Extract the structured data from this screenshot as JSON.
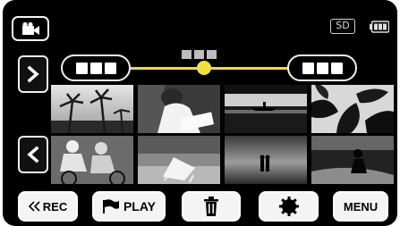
{
  "top_bar": {
    "mode_icon": "video-camera-icon",
    "storage_label": "SD",
    "battery_icon": "battery-icon"
  },
  "date_bar": {
    "prev_date_icon": "date-placeholder",
    "next_date_icon": "date-placeholder",
    "slider_color": "#e8df3a"
  },
  "nav": {
    "next_page_icon": "chevron-right-icon",
    "prev_page_icon": "chevron-left-icon"
  },
  "thumbnails": [
    {
      "subject": "palm-trees"
    },
    {
      "subject": "reading-person"
    },
    {
      "subject": "canoe-on-lake"
    },
    {
      "subject": "leaves"
    },
    {
      "subject": "cyclists"
    },
    {
      "subject": "beach-chair"
    },
    {
      "subject": "couple-on-beach"
    },
    {
      "subject": "running-child"
    }
  ],
  "bottom_bar": {
    "rec_label": "REC",
    "play_label": "PLAY",
    "delete_icon": "trash-icon",
    "settings_icon": "gear-icon",
    "menu_label": "MENU"
  }
}
